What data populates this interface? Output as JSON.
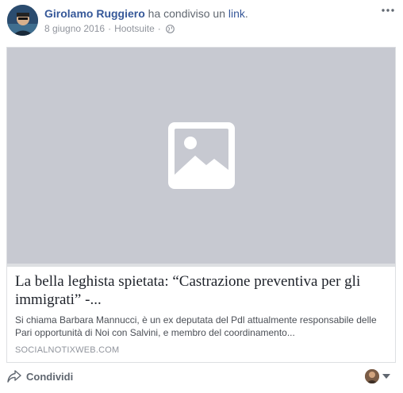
{
  "post": {
    "author": "Girolamo Ruggiero",
    "action_text": " ha condiviso un ",
    "link_word": "link",
    "period": ".",
    "date": "8 giugno 2016",
    "separator": "·",
    "via": "Hootsuite",
    "separator2": "·",
    "privacy_icon": "globe-icon"
  },
  "link_preview": {
    "image_icon": "image-placeholder-icon",
    "title": "La bella leghista spietata: “Castrazione preventiva per gli immigrati” -...",
    "description": "Si chiama Barbara Mannucci, è un ex deputata del Pdl attualmente responsabile delle Pari opportunità di Noi con Salvini, e membro del coordinamento...",
    "domain": "SOCIALNOTIXWEB.COM"
  },
  "actions": {
    "share_label": "Condividi",
    "share_icon": "share-icon",
    "audience_icon": "avatar"
  },
  "colors": {
    "author": "#365899",
    "meta": "#90949c",
    "placeholder_bg": "#c7c9d1",
    "title": "#1d2129"
  }
}
